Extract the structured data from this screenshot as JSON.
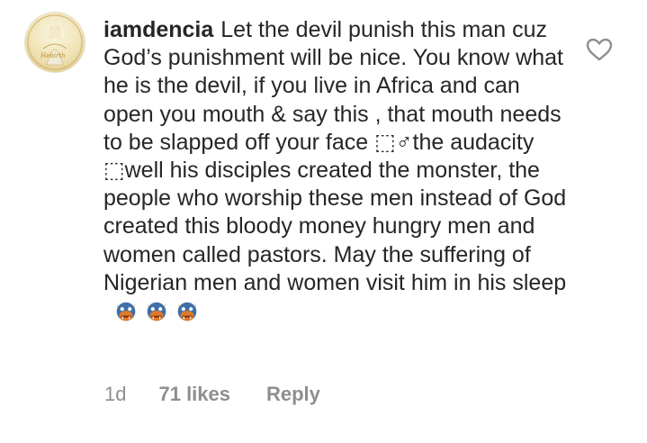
{
  "comment": {
    "username": "iamdencia",
    "text": "Let the devil punish this man cuz God’s punishment will be nice. You know what he is the devil, if you live in Africa and can open you mouth & say this , that mouth needs to be slapped off your face ⬚♂the audacity ⬚well his disciples created the monster, the people who worship these men instead of God created this bloody money hungry men and women called pastors. May the suffering of Nigerian men and women visit him in his sleep",
    "emoji_icons": [
      "ogre-face-icon",
      "ogre-face-icon",
      "ogre-face-icon"
    ],
    "timestamp": "1d",
    "likes": "71 likes",
    "reply_label": "Reply"
  },
  "avatar": {
    "icon": "profile-avatar",
    "logo_text": "Hebirth"
  },
  "colors": {
    "text": "#262626",
    "meta": "#8e8e8e",
    "ogre": "#3f6fa8",
    "ogre_accent": "#e07a2a"
  }
}
